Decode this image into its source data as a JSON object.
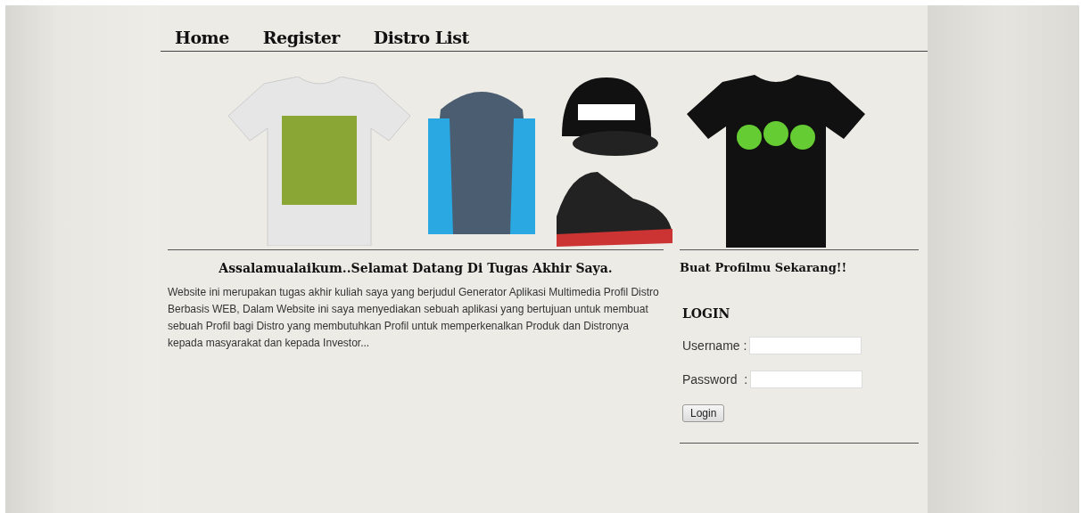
{
  "nav": [
    {
      "label": "Home"
    },
    {
      "label": "Register"
    },
    {
      "label": "Distro List"
    }
  ],
  "welcome": {
    "title": "Assalamualaikum..Selamat Datang Di Tugas Akhir Saya.",
    "body": "Website ini merupakan tugas akhir kuliah saya yang berjudul Generator Aplikasi Multimedia Profil Distro Berbasis WEB, Dalam Website ini saya menyediakan sebuah aplikasi yang bertujuan untuk membuat sebuah Profil bagi Distro yang membutuhkan Profil untuk memperkenalkan Produk dan Distronya kepada masyarakat dan kepada Investor..."
  },
  "sidebar": {
    "title": "Buat Profilmu Sekarang!!",
    "login": {
      "heading": "LOGIN",
      "fields": [
        {
          "label": "Username :"
        },
        {
          "label": "Password  :"
        }
      ],
      "button": "Login"
    }
  }
}
